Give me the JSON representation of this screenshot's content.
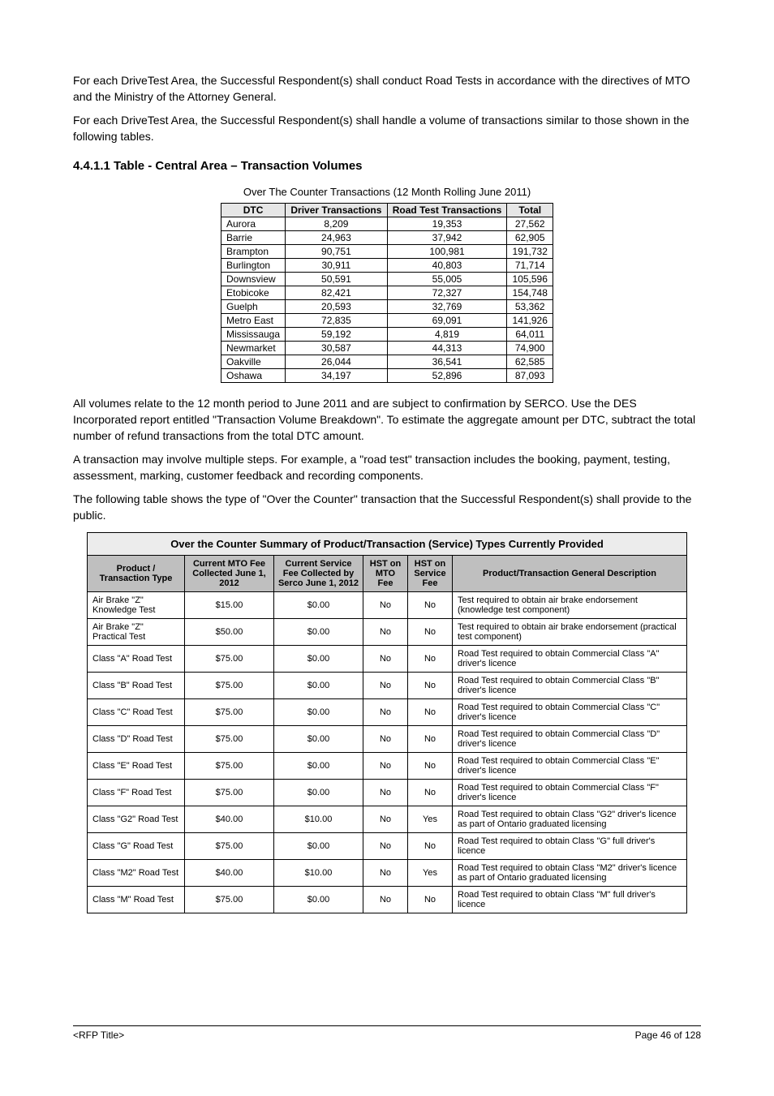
{
  "intro1": "For each DriveTest Area, the Successful Respondent(s) shall conduct Road Tests in accordance with the directives of MTO and the Ministry of the Attorney General.",
  "intro2": "For each DriveTest Area, the Successful Respondent(s) shall handle a volume of transactions similar to those shown in the following tables.",
  "heading1": "4.4.1.1 Table - Central Area – Transaction Volumes",
  "table1_caption": "Over The Counter Transactions (12 Month Rolling June 2011)",
  "table1_headers": [
    "DTC",
    "Driver Transactions",
    "Road Test Transactions",
    "Total"
  ],
  "table1_rows": [
    [
      "Aurora",
      "8,209",
      "19,353",
      "27,562"
    ],
    [
      "Barrie",
      "24,963",
      "37,942",
      "62,905"
    ],
    [
      "Brampton",
      "90,751",
      "100,981",
      "191,732"
    ],
    [
      "Burlington",
      "30,911",
      "40,803",
      "71,714"
    ],
    [
      "Downsview",
      "50,591",
      "55,005",
      "105,596"
    ],
    [
      "Etobicoke",
      "82,421",
      "72,327",
      "154,748"
    ],
    [
      "Guelph",
      "20,593",
      "32,769",
      "53,362"
    ],
    [
      "Metro East",
      "72,835",
      "69,091",
      "141,926"
    ],
    [
      "Mississauga",
      "59,192",
      "4,819",
      "64,011"
    ],
    [
      "Newmarket",
      "30,587",
      "44,313",
      "74,900"
    ],
    [
      "Oakville",
      "26,044",
      "36,541",
      "62,585"
    ],
    [
      "Oshawa",
      "34,197",
      "52,896",
      "87,093"
    ]
  ],
  "para1a": "All volumes relate to the 12 month period to June 2011 and are subject to confirmation by SERCO. Use the DES Incorporated report entitled \"Transaction Volume Breakdown\". To estimate the aggregate amount per DTC, subtract the total number of refund transactions from the total DTC amount.",
  "para1b": "A transaction may involve multiple steps. For example, a \"road test\" transaction includes the booking, payment, testing, assessment, marking, customer feedback and recording components.",
  "para2a": "The following table shows the type of \"Over the Counter\" transaction that the Successful Respondent(s) shall provide to the public.",
  "table2_title": "Over the Counter Summary of Product/Transaction (Service) Types Currently Provided",
  "table2_headers": [
    "Product / Transaction Type",
    "Current MTO Fee Collected June 1, 2012",
    "Current Service Fee Collected by Serco June 1, 2012",
    "HST on MTO Fee",
    "HST on Service Fee",
    "Product/Transaction General Description"
  ],
  "table2_rows": [
    [
      "Air Brake \"Z\" Knowledge Test",
      "$15.00",
      "$0.00",
      "No",
      "No",
      "Test required to obtain air brake endorsement (knowledge test component)"
    ],
    [
      "Air Brake \"Z\" Practical Test",
      "$50.00",
      "$0.00",
      "No",
      "No",
      "Test required to obtain air brake endorsement (practical test component)"
    ],
    [
      "Class \"A\" Road Test",
      "$75.00",
      "$0.00",
      "No",
      "No",
      "Road Test required to obtain Commercial Class \"A\" driver's licence"
    ],
    [
      "Class \"B\" Road Test",
      "$75.00",
      "$0.00",
      "No",
      "No",
      "Road Test required to obtain Commercial Class \"B\" driver's licence"
    ],
    [
      "Class \"C\" Road Test",
      "$75.00",
      "$0.00",
      "No",
      "No",
      "Road Test required to obtain Commercial Class \"C\" driver's licence"
    ],
    [
      "Class \"D\" Road Test",
      "$75.00",
      "$0.00",
      "No",
      "No",
      "Road Test required to obtain Commercial Class \"D\" driver's licence"
    ],
    [
      "Class \"E\" Road Test",
      "$75.00",
      "$0.00",
      "No",
      "No",
      "Road Test required to obtain Commercial Class \"E\" driver's licence"
    ],
    [
      "Class \"F\" Road Test",
      "$75.00",
      "$0.00",
      "No",
      "No",
      "Road Test required to obtain Commercial Class \"F\" driver's licence"
    ],
    [
      "Class \"G2\" Road Test",
      "$40.00",
      "$10.00",
      "No",
      "Yes",
      "Road Test required to obtain Class \"G2\" driver's licence as part of Ontario graduated licensing"
    ],
    [
      "Class \"G\" Road Test",
      "$75.00",
      "$0.00",
      "No",
      "No",
      "Road Test required to obtain Class \"G\" full driver's licence"
    ],
    [
      "Class \"M2\" Road Test",
      "$40.00",
      "$10.00",
      "No",
      "Yes",
      "Road Test required to obtain Class \"M2\" driver's licence as part of Ontario graduated licensing"
    ],
    [
      "Class \"M\" Road Test",
      "$75.00",
      "$0.00",
      "No",
      "No",
      "Road Test required to obtain Class \"M\" full driver's licence"
    ]
  ],
  "footer_left": "<RFP Title>",
  "footer_right": "Page 46 of 128"
}
